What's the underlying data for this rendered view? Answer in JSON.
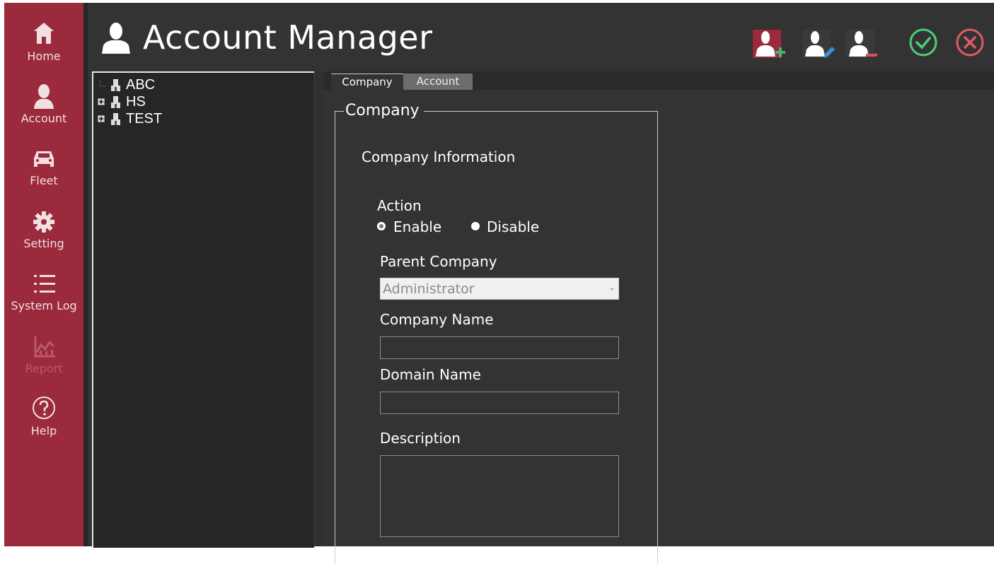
{
  "sidebar": {
    "items": [
      {
        "label": "Home",
        "icon": "home-icon"
      },
      {
        "label": "Account",
        "icon": "account-icon"
      },
      {
        "label": "Fleet",
        "icon": "car-icon"
      },
      {
        "label": "Setting",
        "icon": "gear-icon"
      },
      {
        "label": "System Log",
        "icon": "list-icon"
      },
      {
        "label": "Report",
        "icon": "chart-icon",
        "disabled": true
      },
      {
        "label": "Help",
        "icon": "help-icon"
      }
    ]
  },
  "header": {
    "title": "Account Manager",
    "toolbar": [
      "add-user-icon",
      "edit-user-icon",
      "remove-user-icon",
      "confirm-icon",
      "cancel-icon"
    ]
  },
  "tree": {
    "nodes": [
      {
        "label": "ABC",
        "expandable": false
      },
      {
        "label": "HS",
        "expandable": true
      },
      {
        "label": "TEST",
        "expandable": true
      }
    ]
  },
  "tabs": [
    "Company",
    "Account"
  ],
  "form": {
    "group_title": "Company",
    "section_title": "Company Information",
    "action_label": "Action",
    "radio_enable": "Enable",
    "radio_disable": "Disable",
    "parent_company_label": "Parent Company",
    "parent_company_value": "Administrator",
    "company_name_label": "Company Name",
    "company_name_value": "",
    "domain_name_label": "Domain Name",
    "domain_name_value": "",
    "description_label": "Description",
    "description_value": ""
  },
  "colors": {
    "sidebar": "#9b2a3c",
    "background": "#333333",
    "tree_background": "#262626",
    "add_accent": "#4caf6a",
    "edit_accent": "#3b8fd6",
    "remove_accent": "#d9534f",
    "confirm": "#4ccf7a",
    "cancel": "#e05a66"
  }
}
